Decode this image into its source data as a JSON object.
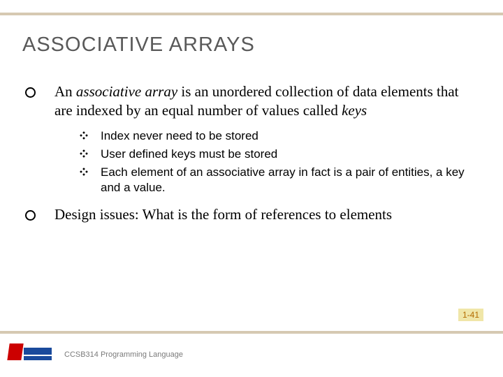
{
  "title": "ASSOCIATIVE ARRAYS",
  "bullets": [
    {
      "html": "An <span class='italic'>associative array</span> is an unordered collection of data elements that are indexed by an equal number of values called <span class='italic'>keys</span>",
      "sub": [
        "Index never need to be stored",
        "User defined keys must be stored",
        "Each element of an associative array in fact is a pair of entities, a key and a value."
      ]
    },
    {
      "html": "Design issues: What is the form of references to elements",
      "sub": []
    }
  ],
  "slide_number": "1-41",
  "footer": "CCSB314 Programming Language"
}
